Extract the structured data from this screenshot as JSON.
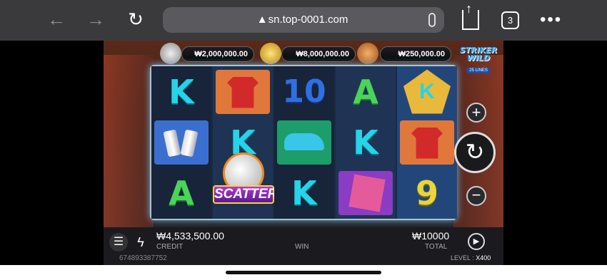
{
  "browser": {
    "url": "sn.top-0001.com",
    "tab_count": "3",
    "back_icon": "←",
    "forward_icon": "→",
    "reload_icon": "↻",
    "more_icon": "•••"
  },
  "game": {
    "jackpots": [
      {
        "tier": "silver",
        "value": "₩2,000,000.00"
      },
      {
        "tier": "gold",
        "value": "₩8,000,000.00"
      },
      {
        "tier": "bronze",
        "value": "₩250,000.00"
      }
    ],
    "logo": {
      "title_line1": "STRIKER",
      "title_line2": "WILD",
      "subtitle": "25 LINES"
    },
    "reels": [
      [
        "K",
        "energy-drink-cans",
        "A"
      ],
      [
        "red-jersey-medal",
        "K",
        "SCATTER"
      ],
      [
        "10",
        "football-boot",
        "K"
      ],
      [
        "A",
        "K",
        "newspaper-magnifier"
      ],
      [
        "K-shield",
        "red-jersey-medal",
        "9"
      ]
    ],
    "scatter_label": "SCATTER",
    "controls": {
      "plus": "+",
      "minus": "−",
      "spin": "↻",
      "menu": "☰",
      "bolt": "ϟ",
      "auto": "▶"
    },
    "credit_value": "₩4,533,500.00",
    "credit_label": "CREDIT",
    "win_label": "WIN",
    "total_value": "₩10000",
    "total_label": "TOTAL",
    "round_id": "674893387752",
    "level_label": "LEVEL :",
    "level_value": "X400"
  },
  "colors": {
    "k": "#25d4e6",
    "a": "#4bd35a",
    "ten": "#2f6fe3",
    "nine": "#e8d63a"
  }
}
